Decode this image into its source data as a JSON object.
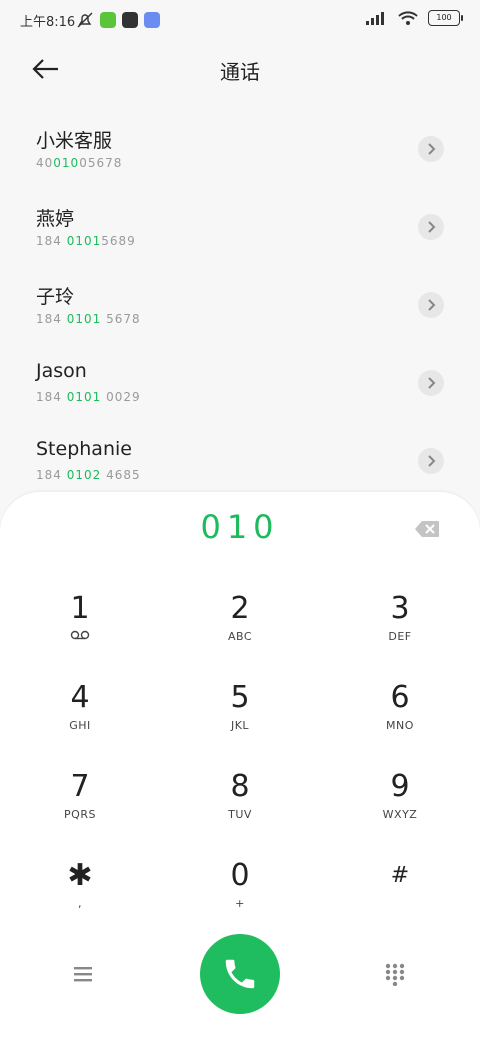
{
  "status_bar": {
    "time": "上午8:16",
    "battery": "100"
  },
  "header": {
    "title": "通话"
  },
  "contacts": [
    {
      "name": "小米客服",
      "number_parts": [
        "40",
        "010",
        "05678"
      ]
    },
    {
      "name": "燕婷",
      "number_parts": [
        "184 ",
        "0101",
        "5689"
      ]
    },
    {
      "name": "子玲",
      "number_parts": [
        "184 ",
        "0101",
        " 5678"
      ]
    },
    {
      "name": "Jason",
      "number_parts": [
        "184 ",
        "0101",
        " 0029"
      ]
    },
    {
      "name": "Stephanie",
      "number_parts": [
        "184 ",
        "0102",
        " 4685"
      ]
    }
  ],
  "dialpad": {
    "input_value": "010",
    "keys": [
      {
        "digit": "1",
        "letters": "voicemail-icon"
      },
      {
        "digit": "2",
        "letters": "ABC"
      },
      {
        "digit": "3",
        "letters": "DEF"
      },
      {
        "digit": "4",
        "letters": "GHI"
      },
      {
        "digit": "5",
        "letters": "JKL"
      },
      {
        "digit": "6",
        "letters": "MNO"
      },
      {
        "digit": "7",
        "letters": "PQRS"
      },
      {
        "digit": "8",
        "letters": "TUV"
      },
      {
        "digit": "9",
        "letters": "WXYZ"
      },
      {
        "digit": "✱",
        "letters": ","
      },
      {
        "digit": "0",
        "letters": "+"
      },
      {
        "digit": "#",
        "letters": ""
      }
    ]
  },
  "colors": {
    "accent": "#1dbb5c",
    "call_button": "#1fbd5f",
    "background": "#f7f7f7"
  }
}
